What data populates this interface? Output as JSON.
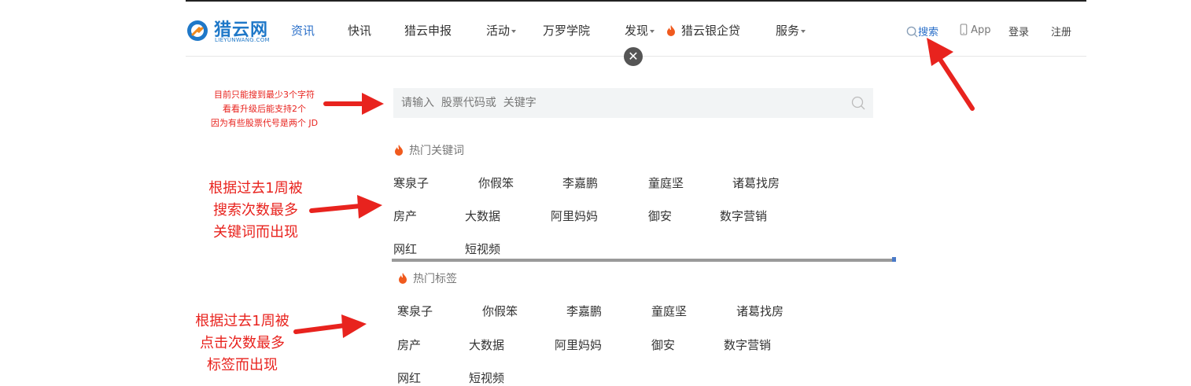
{
  "header": {
    "logo_text": "猎云网",
    "logo_sub": "LIEYUNWANG.COM",
    "nav": [
      {
        "label": "资讯",
        "active": true
      },
      {
        "label": "快讯"
      },
      {
        "label": "猎云申报"
      },
      {
        "label": "活动",
        "dropdown": true
      },
      {
        "label": "万罗学院"
      },
      {
        "label": "发现",
        "dropdown": true
      },
      {
        "label": "猎云银企贷",
        "fire": true
      },
      {
        "label": "服务",
        "dropdown": true
      }
    ],
    "search_label": "搜索",
    "app_label": "App",
    "login_label": "登录",
    "register_label": "注册"
  },
  "search": {
    "placeholder": "请输入  股票代码或  关键字"
  },
  "hot_keywords": {
    "title": "热门关键词",
    "items": [
      "寒泉子",
      "你假笨",
      "李嘉鹏",
      "童庭坚",
      "诸葛找房",
      "房产",
      "大数据",
      "阿里妈妈",
      "御安",
      "数字营销",
      "网红",
      "短视频"
    ]
  },
  "hot_tags": {
    "title": "热门标签",
    "items": [
      "寒泉子",
      "你假笨",
      "李嘉鹏",
      "童庭坚",
      "诸葛找房",
      "房产",
      "大数据",
      "阿里妈妈",
      "御安",
      "数字营销",
      "网红",
      "短视频"
    ]
  },
  "annotations": {
    "search_note": [
      "目前只能搜到最少3个字符",
      "看看升级后能支持2个",
      "因为有些股票代号是两个  JD"
    ],
    "keywords_note": [
      "根据过去1周被",
      "搜索次数最多",
      "关键词而出现"
    ],
    "tags_note": [
      "根据过去1周被",
      "点击次数最多",
      "标签而出现"
    ]
  },
  "colors": {
    "accent": "#2a6fc9",
    "annotation": "#e8231e",
    "fire": "#f05a1e"
  }
}
